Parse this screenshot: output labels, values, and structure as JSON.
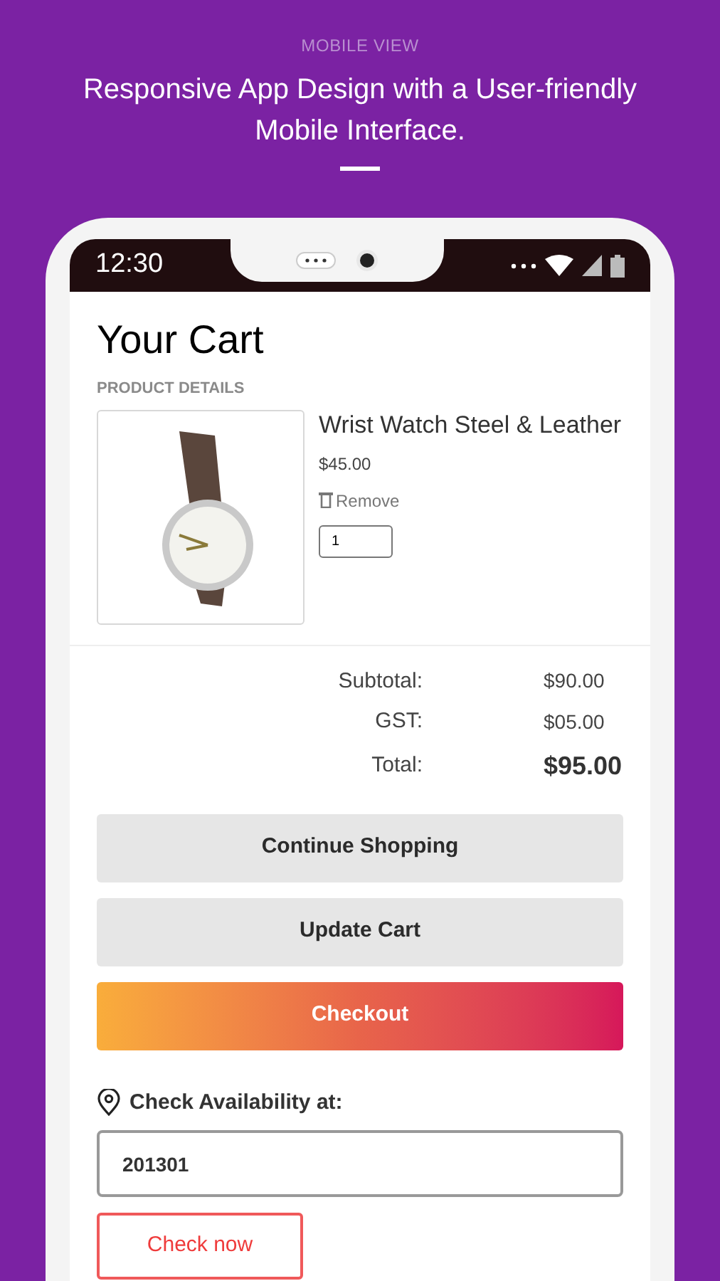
{
  "header": {
    "eyebrow": "MOBILE VIEW",
    "title": "Responsive App Design with a User-friendly Mobile Interface."
  },
  "status_bar": {
    "time": "12:30"
  },
  "cart": {
    "title": "Your Cart",
    "section_label": "PRODUCT DETAILS",
    "items": [
      {
        "name": "Wrist Watch Steel & Leather",
        "price": "$45.00",
        "remove_label": "Remove",
        "quantity": "1"
      }
    ]
  },
  "totals": [
    {
      "kind": "normal",
      "label": "Subtotal:",
      "value": "$90.00"
    },
    {
      "kind": "normal",
      "label": "GST:",
      "value": "$05.00"
    },
    {
      "kind": "grand",
      "label": "Total:",
      "value": "$95.00"
    }
  ],
  "buttons": [
    {
      "kind": "secondary",
      "label": "Continue Shopping"
    },
    {
      "kind": "secondary",
      "label": "Update Cart"
    },
    {
      "kind": "primary",
      "label": "Checkout"
    }
  ],
  "availability": {
    "label": "Check Availability at:",
    "value": "201301",
    "button": "Check now"
  }
}
